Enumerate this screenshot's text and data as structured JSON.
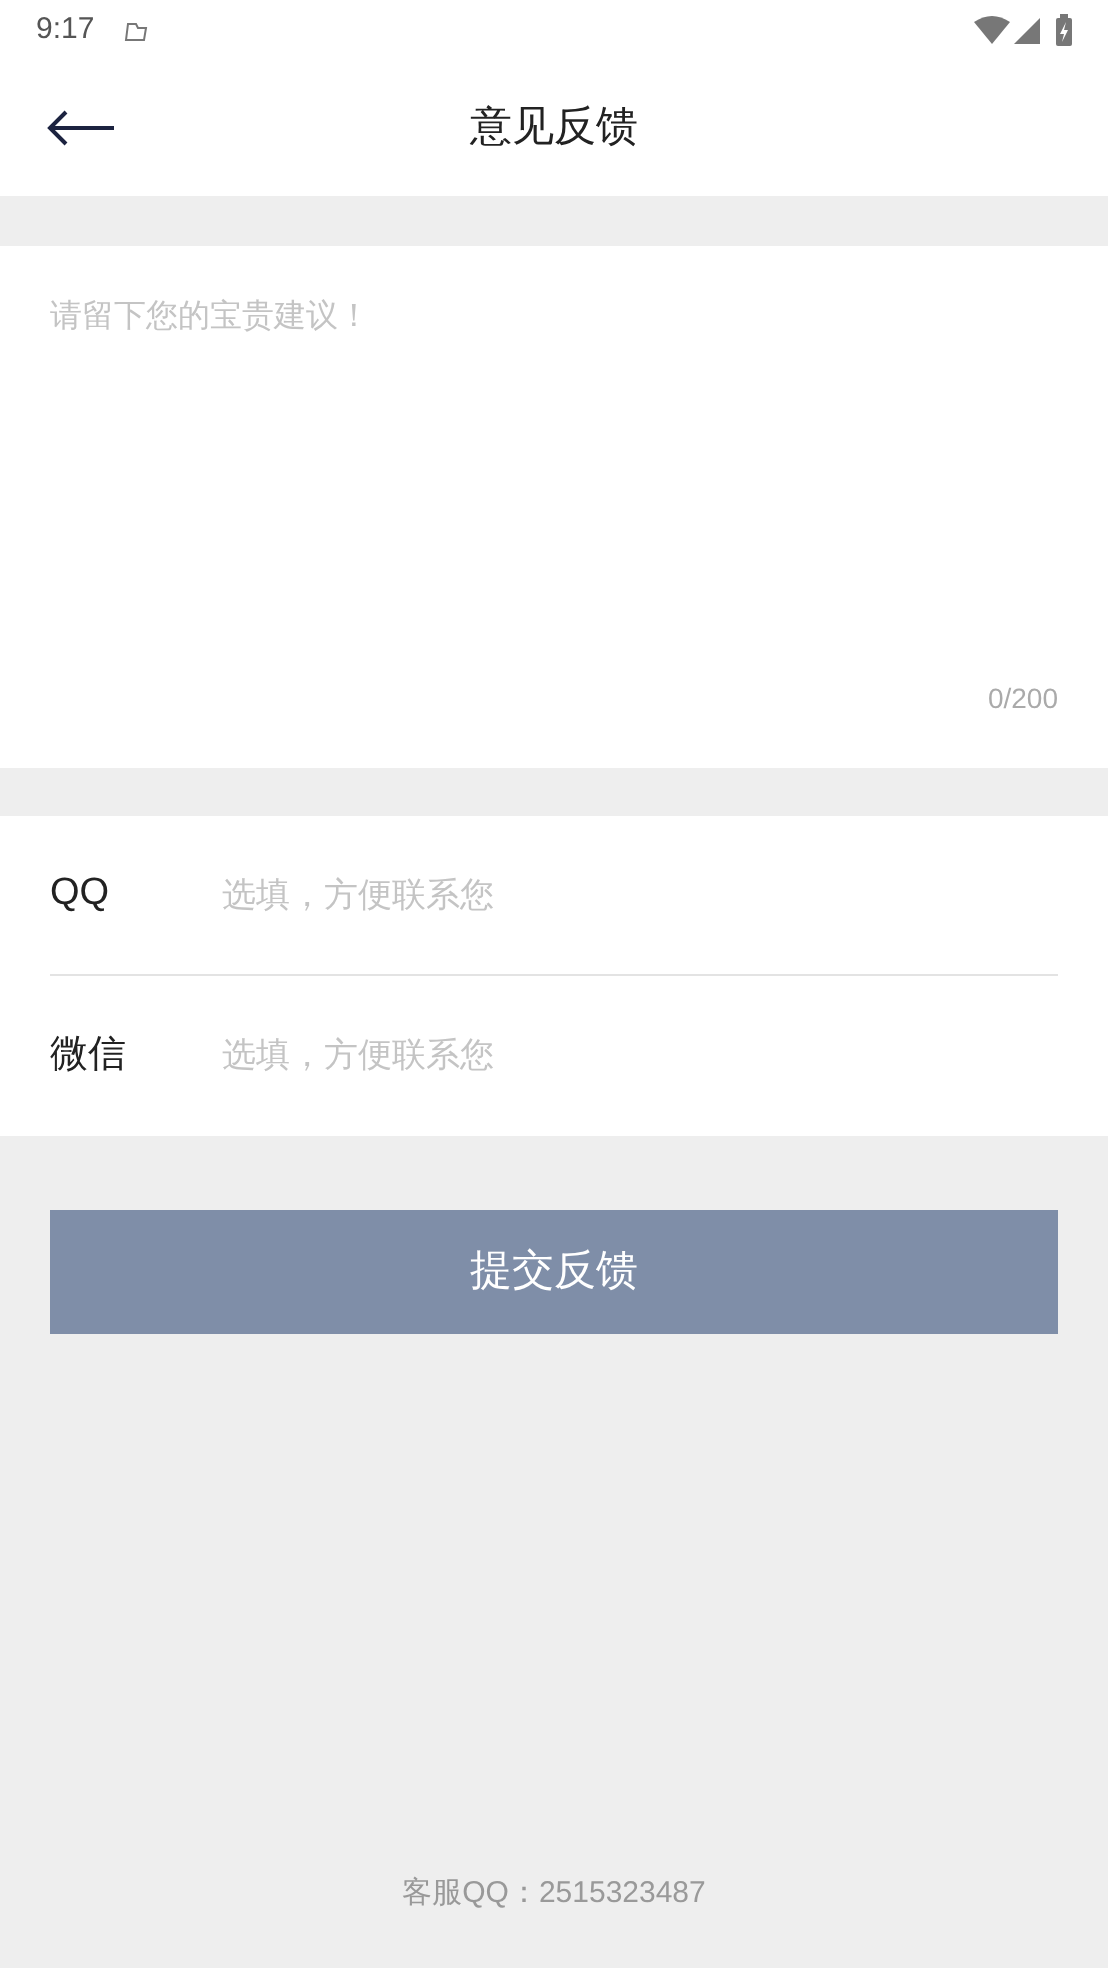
{
  "status_bar": {
    "time": "9:17"
  },
  "header": {
    "title": "意见反馈"
  },
  "feedback": {
    "placeholder": "请留下您的宝贵建议！",
    "counter": "0/200"
  },
  "contacts": [
    {
      "label": "QQ",
      "placeholder": "选填，方便联系您"
    },
    {
      "label": "微信",
      "placeholder": "选填，方便联系您"
    }
  ],
  "submit_button": {
    "label": "提交反馈"
  },
  "footer": {
    "text": "客服QQ：2515323487"
  }
}
